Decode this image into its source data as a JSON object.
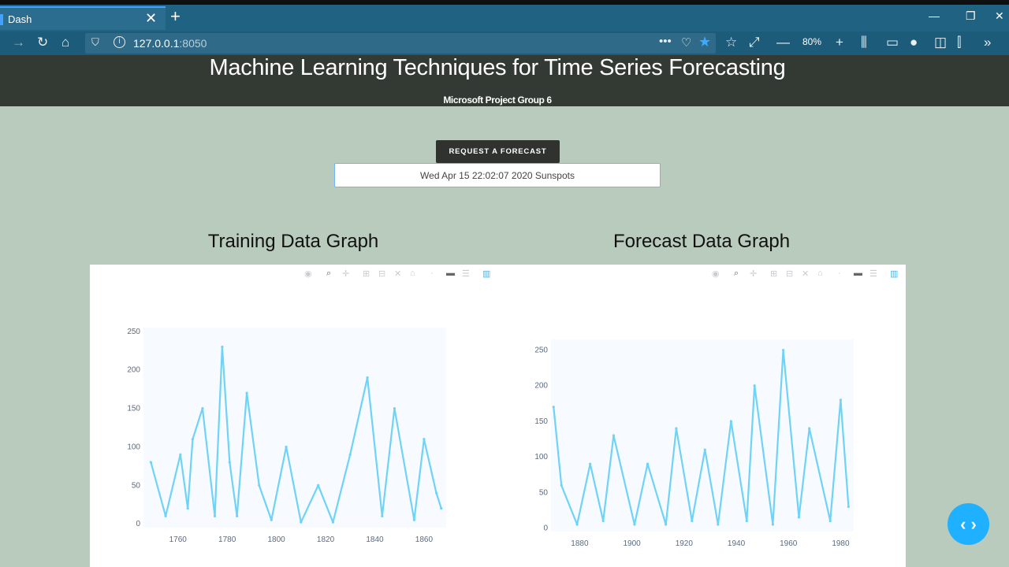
{
  "browser": {
    "tab_title": "Dash",
    "url_host": "127.0.0.1",
    "url_port": ":8050",
    "zoom": "80%",
    "accent": "#45a1ff"
  },
  "header": {
    "title": "Machine Learning Techniques for Time Series Forecasting",
    "subtitle": "Microsoft Project Group 6"
  },
  "controls": {
    "request_button": "REQUEST A FORECAST",
    "request_value": "Wed Apr 15 22:02:07 2020 Sunspots"
  },
  "graphs": {
    "training_title": "Training Data Graph",
    "forecast_title": "Forecast Data Graph"
  },
  "chart_data": [
    {
      "type": "line",
      "color": "#6fd3f7",
      "x": [
        1749,
        1755,
        1761,
        1764,
        1766,
        1770,
        1775,
        1778,
        1781,
        1784,
        1788,
        1793,
        1798,
        1804,
        1810,
        1817,
        1823,
        1830,
        1837,
        1843,
        1848,
        1856,
        1860,
        1865,
        1867
      ],
      "y": [
        80,
        10,
        90,
        20,
        110,
        150,
        10,
        230,
        80,
        10,
        170,
        50,
        5,
        100,
        2,
        50,
        2,
        90,
        190,
        10,
        150,
        5,
        110,
        40,
        20
      ],
      "xlim": [
        1746,
        1869
      ],
      "ylim": [
        -5,
        255
      ],
      "xticks": [
        "1760",
        "1780",
        "1800",
        "1820",
        "1840",
        "1860"
      ],
      "yticks": [
        "0",
        "50",
        "100",
        "150",
        "200",
        "250"
      ]
    },
    {
      "type": "line",
      "color": "#6fd3f7",
      "x": [
        1870,
        1873,
        1879,
        1884,
        1889,
        1893,
        1901,
        1906,
        1913,
        1917,
        1923,
        1928,
        1933,
        1938,
        1944,
        1947,
        1954,
        1958,
        1964,
        1968,
        1976,
        1980,
        1983
      ],
      "y": [
        170,
        60,
        5,
        90,
        10,
        130,
        5,
        90,
        5,
        140,
        10,
        110,
        5,
        150,
        10,
        200,
        5,
        250,
        15,
        140,
        10,
        180,
        30
      ],
      "xlim": [
        1869,
        1985
      ],
      "ylim": [
        -5,
        265
      ],
      "xticks": [
        "1880",
        "1900",
        "1920",
        "1940",
        "1960",
        "1980"
      ],
      "yticks": [
        "0",
        "50",
        "100",
        "150",
        "200",
        "250"
      ]
    }
  ]
}
